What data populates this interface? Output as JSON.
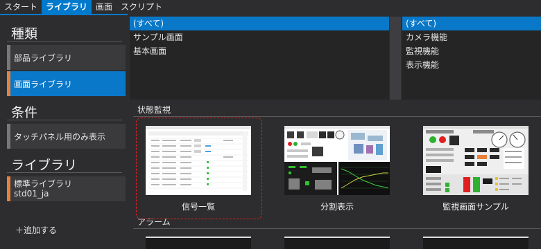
{
  "menu": {
    "tabs": [
      {
        "label": "スタート",
        "active": false
      },
      {
        "label": "ライブラリ",
        "active": true
      },
      {
        "label": "画面",
        "active": false
      },
      {
        "label": "スクリプト",
        "active": false
      }
    ]
  },
  "sidebar": {
    "kind": {
      "title": "種類",
      "items": [
        "部品ライブラリ",
        "画面ライブラリ"
      ],
      "selected": "画面ライブラリ"
    },
    "condition": {
      "title": "条件",
      "items": [
        "タッチパネル用のみ表示"
      ]
    },
    "library": {
      "title": "ライブラリ",
      "item_name": "標準ライブラリ",
      "item_sub": "std01_ja",
      "add_label": "＋追加する"
    }
  },
  "category_list": {
    "items": [
      "(すべて)",
      "サンプル画面",
      "基本画面"
    ],
    "selected": "(すべて)"
  },
  "function_list": {
    "items": [
      "(すべて)",
      "カメラ機能",
      "監視機能",
      "表示機能"
    ],
    "selected": "(すべて)"
  },
  "gallery": {
    "groups": [
      {
        "title": "状態監視",
        "cards": [
          {
            "caption": "信号一覧"
          },
          {
            "caption": "分割表示"
          },
          {
            "caption": "監視画面サンプル"
          }
        ]
      },
      {
        "title": "アラーム"
      }
    ]
  },
  "colors": {
    "accent": "#007acc",
    "selection": "#0a78c8",
    "indicator": "#e8813a",
    "focus_border": "#e02020",
    "background": "#2d2d30"
  }
}
